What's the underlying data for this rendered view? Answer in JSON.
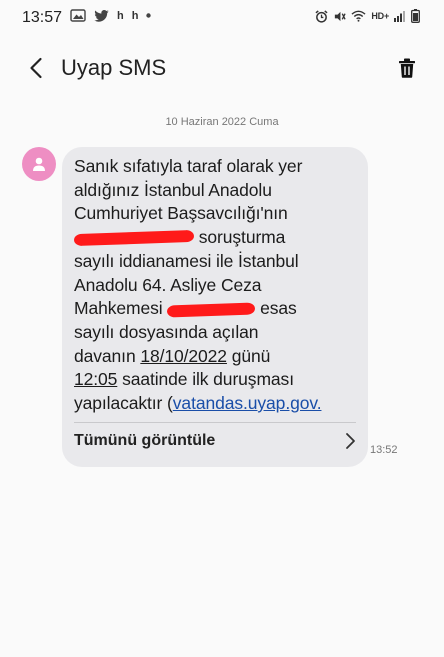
{
  "status_bar": {
    "time": "13:57",
    "network_label": "HD+",
    "left_icons": [
      "gallery-icon",
      "twitter-icon",
      "h-notification-icon",
      "h-notification-icon",
      "dot-icon"
    ],
    "right_icons": [
      "alarm-icon",
      "mute-icon",
      "wifi-icon",
      "signal-icon",
      "battery-icon"
    ]
  },
  "app_bar": {
    "title": "Uyap SMS",
    "back_icon": "back-arrow-icon",
    "delete_icon": "trash-icon"
  },
  "conversation": {
    "date_label": "10 Haziran 2022 Cuma",
    "avatar_color": "#ee8ec3",
    "bubble_color": "#e9e9ec",
    "message": {
      "line1": "Sanık sıfatıyla taraf olarak yer",
      "line2": "aldığınız İstanbul Anadolu",
      "line3": "Cumhuriyet Başsavcılığı'nın",
      "line4_after": "soruşturma",
      "line5": "sayılı iddianamesi ile İstanbul",
      "line6": "Anadolu 64. Asliye Ceza",
      "line7_before": "Mahkemesi",
      "line7_after": "esas",
      "line8": "sayılı dosyasında açılan",
      "line9_before": "davanın",
      "line9_date": "18/10/2022",
      "line9_after": "günü",
      "line10_time": "12:05",
      "line10_after": "saatinde ilk duruşması",
      "line11_before": "yapılacaktır (",
      "line11_link": "vatandas.uyap.gov."
    },
    "view_all_label": "Tümünü görüntüle",
    "time": "13:52"
  }
}
